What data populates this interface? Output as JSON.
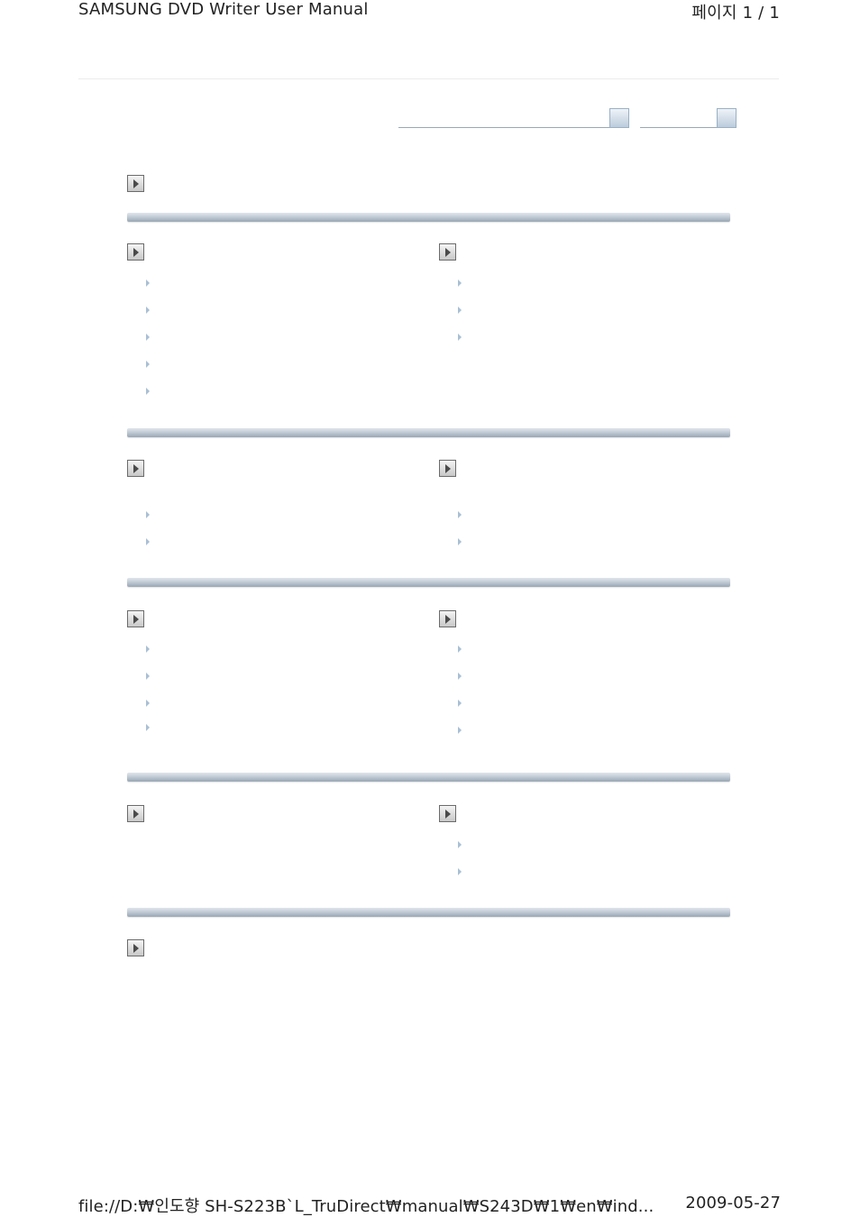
{
  "header": {
    "title": "SAMSUNG DVD Writer User Manual",
    "page_indicator": "페이지 1 / 1"
  },
  "footer": {
    "path": "file://D:₩인도향 SH-S223B`L_TruDirect₩manual₩S243D₩1₩en₩ind...",
    "date": "2009-05-27"
  },
  "controls": {
    "icons": {
      "section": "play-arrow-icon",
      "bullet": "small-triangle-bullet-icon",
      "dropdown": "dropdown-button-icon"
    },
    "colors": {
      "bar": "#a9b6c3",
      "bullet": "#a9bfd4",
      "dropdown_button": "#c9d7e4"
    }
  }
}
